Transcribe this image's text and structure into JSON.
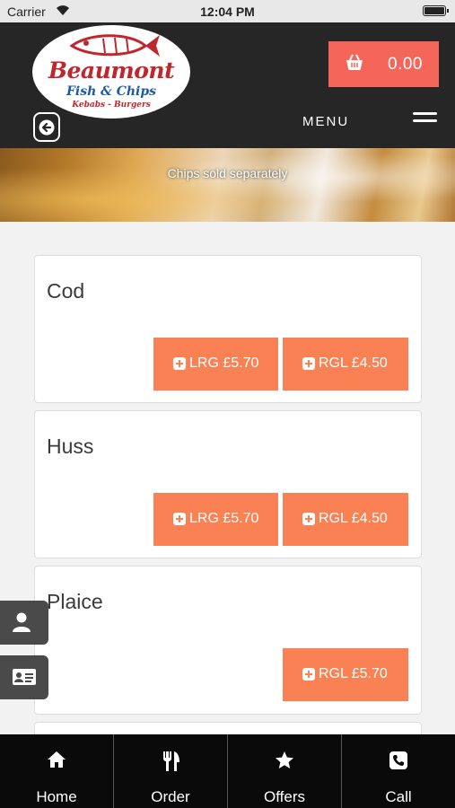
{
  "status_bar": {
    "carrier": "Carrier",
    "time": "12:04 PM"
  },
  "header": {
    "logo": {
      "brand": "Beaumont",
      "subtitle": "Fish & Chips",
      "tagline": "Kebabs - Burgers"
    },
    "cart_total": "0.00",
    "menu_label": "MENU"
  },
  "banner": {
    "note": "Chips sold separately"
  },
  "items": [
    {
      "name": "Cod",
      "buttons": [
        {
          "label": "LRG £5.70"
        },
        {
          "label": "RGL £4.50"
        }
      ]
    },
    {
      "name": "Huss",
      "buttons": [
        {
          "label": "LRG £5.70"
        },
        {
          "label": "RGL £4.50"
        }
      ]
    },
    {
      "name": "Plaice",
      "buttons": [
        {
          "label": "RGL £5.70"
        }
      ]
    }
  ],
  "bottom_nav": [
    {
      "label": "Home",
      "icon": "home-icon"
    },
    {
      "label": "Order",
      "icon": "cutlery-icon"
    },
    {
      "label": "Offers",
      "icon": "star-icon"
    },
    {
      "label": "Call",
      "icon": "phone-icon"
    }
  ],
  "colors": {
    "header_bg": "#262626",
    "cart_bg": "#f4655a",
    "button_bg": "#f98154",
    "nav_bg": "#0a0a0a"
  }
}
